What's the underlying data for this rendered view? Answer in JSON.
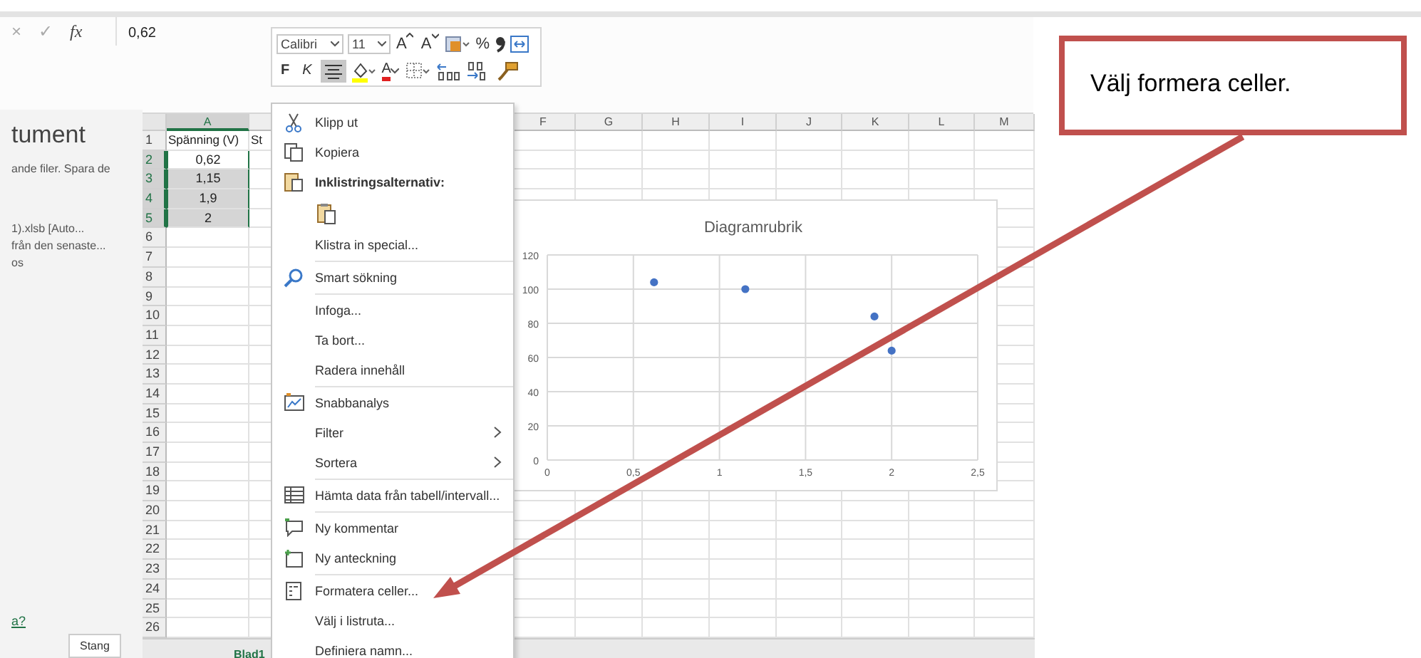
{
  "formula_bar": {
    "cancel": "×",
    "enter": "✓",
    "function": "fx",
    "value": "0,62"
  },
  "backstage": {
    "heading": "tument",
    "text": "ande filer. Spara de",
    "file_name": "1).xlsb  [Auto...",
    "file_note": "från den senaste...",
    "file_time": "os",
    "link": "a?",
    "close_button": "Stang"
  },
  "columns": [
    {
      "label": "A",
      "selected": true
    },
    {
      "label": "F",
      "selected": false
    },
    {
      "label": "G",
      "selected": false
    },
    {
      "label": "H",
      "selected": false
    },
    {
      "label": "I",
      "selected": false
    },
    {
      "label": "J",
      "selected": false
    },
    {
      "label": "K",
      "selected": false
    },
    {
      "label": "L",
      "selected": false
    },
    {
      "label": "M",
      "selected": false
    }
  ],
  "rows": [
    {
      "number": "1",
      "selected": false,
      "active": false,
      "cells": [
        "Spänning (V)",
        "St"
      ]
    },
    {
      "number": "2",
      "selected": true,
      "active": true,
      "cells": [
        "0,62"
      ]
    },
    {
      "number": "3",
      "selected": true,
      "active": false,
      "cells": [
        "1,15"
      ]
    },
    {
      "number": "4",
      "selected": true,
      "active": false,
      "cells": [
        "1,9"
      ]
    },
    {
      "number": "5",
      "selected": true,
      "active": false,
      "cells": [
        "2"
      ]
    },
    {
      "number": "6",
      "selected": false,
      "active": false,
      "cells": []
    },
    {
      "number": "7",
      "selected": false,
      "active": false,
      "cells": []
    },
    {
      "number": "8",
      "selected": false,
      "active": false,
      "cells": []
    },
    {
      "number": "9",
      "selected": false,
      "active": false,
      "cells": []
    },
    {
      "number": "10",
      "selected": false,
      "active": false,
      "cells": []
    },
    {
      "number": "11",
      "selected": false,
      "active": false,
      "cells": []
    },
    {
      "number": "12",
      "selected": false,
      "active": false,
      "cells": []
    },
    {
      "number": "13",
      "selected": false,
      "active": false,
      "cells": []
    },
    {
      "number": "14",
      "selected": false,
      "active": false,
      "cells": []
    },
    {
      "number": "15",
      "selected": false,
      "active": false,
      "cells": []
    },
    {
      "number": "16",
      "selected": false,
      "active": false,
      "cells": []
    },
    {
      "number": "17",
      "selected": false,
      "active": false,
      "cells": []
    },
    {
      "number": "18",
      "selected": false,
      "active": false,
      "cells": []
    },
    {
      "number": "19",
      "selected": false,
      "active": false,
      "cells": []
    },
    {
      "number": "20",
      "selected": false,
      "active": false,
      "cells": []
    },
    {
      "number": "21",
      "selected": false,
      "active": false,
      "cells": []
    },
    {
      "number": "22",
      "selected": false,
      "active": false,
      "cells": []
    },
    {
      "number": "23",
      "selected": false,
      "active": false,
      "cells": []
    },
    {
      "number": "24",
      "selected": false,
      "active": false,
      "cells": []
    },
    {
      "number": "25",
      "selected": false,
      "active": false,
      "cells": []
    },
    {
      "number": "26",
      "selected": false,
      "active": false,
      "cells": []
    }
  ],
  "sheet_tab": "Blad1",
  "mini_toolbar": {
    "row_1": [
      {
        "kind": "font",
        "label": "Calibri"
      },
      {
        "kind": "size",
        "label": "11"
      },
      {
        "kind": "grow",
        "label": "A"
      },
      {
        "kind": "shrink",
        "label": "A"
      },
      {
        "kind": "table-format"
      },
      {
        "kind": "text",
        "label": "%"
      },
      {
        "kind": "comma"
      },
      {
        "kind": "merge"
      }
    ],
    "row_2": [
      {
        "kind": "text-bold",
        "label": "F",
        "selected": false
      },
      {
        "kind": "text-italic",
        "label": "K",
        "selected": false
      },
      {
        "kind": "align",
        "selected": true
      },
      {
        "kind": "fill-color",
        "selected": false
      },
      {
        "kind": "font-color",
        "label": "A",
        "selected": false
      },
      {
        "kind": "borders",
        "selected": false
      },
      {
        "kind": "decimals-more",
        "selected": false
      },
      {
        "kind": "decimals-less",
        "selected": false
      },
      {
        "kind": "painter",
        "selected": false
      }
    ]
  },
  "context_menu": [
    {
      "kind": "cut",
      "label": "Klipp ut"
    },
    {
      "kind": "copy",
      "label": "Kopiera"
    },
    {
      "kind": "paste-header",
      "label": "Inklistringsalternativ:"
    },
    {
      "kind": "paste-option"
    },
    {
      "kind": "plain",
      "label": "Klistra in special..."
    },
    {
      "kind": "separator"
    },
    {
      "kind": "search",
      "label": "Smart sökning"
    },
    {
      "kind": "separator"
    },
    {
      "kind": "plain",
      "label": "Infoga..."
    },
    {
      "kind": "plain",
      "label": "Ta bort..."
    },
    {
      "kind": "plain",
      "label": "Radera innehåll"
    },
    {
      "kind": "separator"
    },
    {
      "kind": "analysis",
      "label": "Snabbanalys"
    },
    {
      "kind": "submenu",
      "label": "Filter"
    },
    {
      "kind": "submenu",
      "label": "Sortera"
    },
    {
      "kind": "separator"
    },
    {
      "kind": "table",
      "label": "Hämta data från tabell/intervall..."
    },
    {
      "kind": "separator"
    },
    {
      "kind": "comment",
      "label": "Ny kommentar"
    },
    {
      "kind": "note",
      "label": "Ny anteckning"
    },
    {
      "kind": "separator"
    },
    {
      "kind": "format",
      "label": "Formatera celler..."
    },
    {
      "kind": "plain",
      "label": "Välj i listruta..."
    },
    {
      "kind": "plain",
      "label": "Definiera namn..."
    }
  ],
  "chart": {
    "chart_data": {
      "type": "scatter",
      "title": "Diagramrubrik",
      "x": [
        0.62,
        1.15,
        1.9,
        2
      ],
      "series": [
        {
          "color": "#4472c4",
          "values": [
            104,
            100,
            84,
            64
          ]
        }
      ],
      "xlim": [
        0,
        2.5
      ],
      "ylim": [
        0,
        120
      ],
      "grid": true,
      "xticks": [
        0,
        {
          "value": 0.5,
          "label": "0,5"
        },
        1,
        {
          "value": 1.5,
          "label": "1,5"
        },
        2,
        {
          "value": 2.5,
          "label": "2,5"
        }
      ],
      "yticks": [
        0,
        20,
        40,
        60,
        80,
        100,
        120
      ]
    }
  },
  "callout": {
    "text": "Välj formera celler."
  }
}
